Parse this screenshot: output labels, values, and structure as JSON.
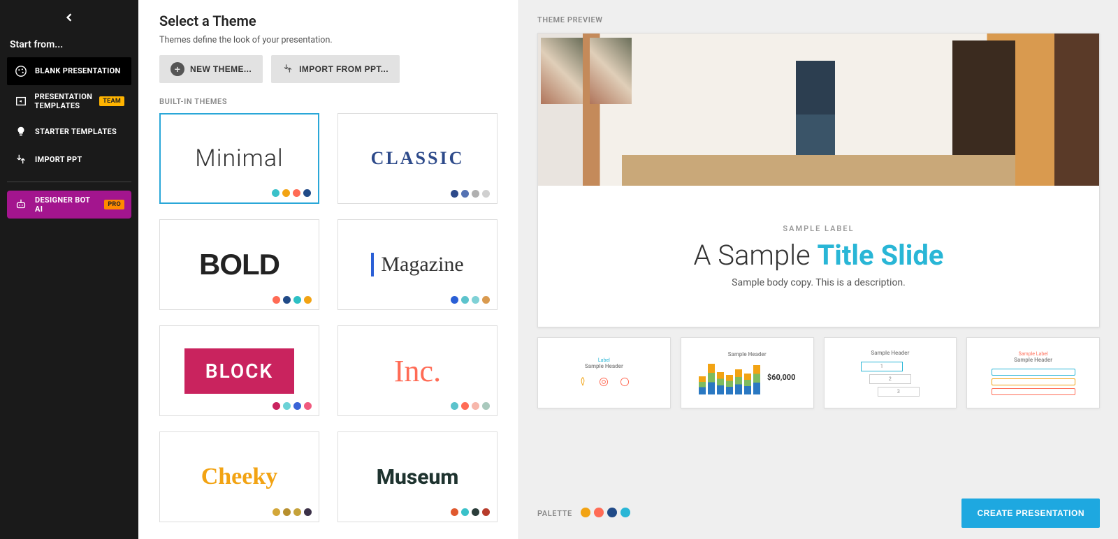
{
  "sidebar": {
    "title": "Start from...",
    "items": {
      "blank": "BLANK PRESENTATION",
      "templates": "PRESENTATION TEMPLATES",
      "starter": "STARTER TEMPLATES",
      "import": "IMPORT PPT",
      "bot": "DESIGNER BOT AI"
    },
    "badges": {
      "team": "TEAM",
      "pro": "PRO"
    }
  },
  "themeSelect": {
    "title": "Select a Theme",
    "subtitle": "Themes define the look of your presentation.",
    "actions": {
      "newTheme": "NEW THEME...",
      "importPpt": "IMPORT FROM PPT..."
    },
    "sectionHeader": "BUILT-IN THEMES",
    "themes": [
      {
        "name": "Minimal",
        "palette": [
          "#3ac1c9",
          "#f2a313",
          "#ff6b55",
          "#204a87"
        ],
        "selected": true
      },
      {
        "name": "CLASSIC",
        "palette": [
          "#2d4a8a",
          "#5573b3",
          "#b0b0b0",
          "#d0d0d0"
        ]
      },
      {
        "name": "BOLD",
        "palette": [
          "#ff6b55",
          "#204a87",
          "#2dc0c4",
          "#f2a313"
        ]
      },
      {
        "name": "Magazine",
        "palette": [
          "#2a5fd6",
          "#5cc3cc",
          "#7fd1d6",
          "#d99a4f"
        ]
      },
      {
        "name": "BLOCK",
        "palette": [
          "#c9235e",
          "#6bd2d6",
          "#3a64d6",
          "#f05a7e"
        ]
      },
      {
        "name": "Inc.",
        "palette": [
          "#5cc3cc",
          "#ff6b55",
          "#f7b7ab",
          "#a9c9bd"
        ]
      },
      {
        "name": "Cheeky",
        "palette": [
          "#d3a739",
          "#b78f2e",
          "#c5a23a",
          "#3b3148"
        ]
      },
      {
        "name": "Museum",
        "palette": [
          "#e0592e",
          "#3ac1c9",
          "#2b3d3a",
          "#b73b2b"
        ]
      }
    ]
  },
  "preview": {
    "header": "THEME PREVIEW",
    "slide": {
      "label": "SAMPLE LABEL",
      "titlePrefix": "A Sample ",
      "titleEmphasis": "Title Slide",
      "body": "Sample body copy. This is a description."
    },
    "thumbs": {
      "t1": {
        "label": "Label",
        "header": "Sample Header"
      },
      "t2": {
        "header": "Sample Header",
        "value": "$60,000"
      },
      "t3": {
        "header": "Sample Header"
      },
      "t4": {
        "label": "Sample Label",
        "header": "Sample Header"
      }
    },
    "footer": {
      "paletteLabel": "PALETTE",
      "palette": [
        "#f2a313",
        "#ff6b55",
        "#204a87",
        "#29b6d6"
      ],
      "createBtn": "CREATE PRESENTATION"
    }
  }
}
